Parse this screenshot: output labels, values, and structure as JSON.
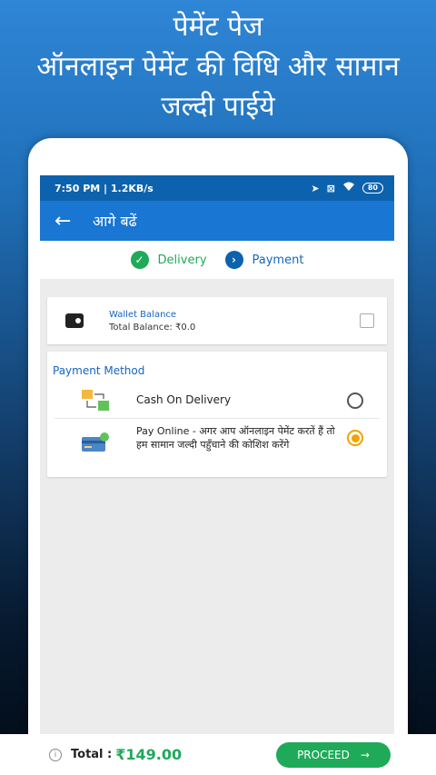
{
  "promo": {
    "line1": "पेमेंट पेज",
    "line2": "ऑनलाइन पेमेंट की विधि और सामान",
    "line3": "जल्दी पाईये"
  },
  "status_bar": {
    "time_speed": "7:50 PM | 1.2KB/s",
    "battery": "80"
  },
  "app_bar": {
    "back_icon": "back-arrow-icon",
    "title": "आगे बढें"
  },
  "stepper": {
    "steps": [
      {
        "label": "Delivery",
        "icon": "check-icon",
        "color": "#1faa59"
      },
      {
        "label": "Payment",
        "icon": "chevron-right-icon",
        "color": "#0d62ad"
      }
    ]
  },
  "wallet": {
    "title": "Wallet Balance",
    "balance": "Total Balance: ₹0.0",
    "checked": false
  },
  "payment_method": {
    "heading": "Payment Method",
    "options": [
      {
        "label": "Cash On Delivery",
        "icon": "cash-delivery-icon",
        "selected": false
      },
      {
        "label": "Pay Online - अगर आप ऑनलाइन पेमेंट करतें हैं तो हम सामान जल्दी पहुँचाने की कोशिश करेंगे",
        "icon": "card-payment-icon",
        "selected": true
      }
    ]
  },
  "bottom": {
    "total_label": "Total :",
    "total_value": "₹149.00",
    "proceed_label": "PROCEED"
  },
  "colors": {
    "primary": "#1976d2",
    "accent_green": "#1faa59",
    "radio_selected": "#f0a400"
  }
}
